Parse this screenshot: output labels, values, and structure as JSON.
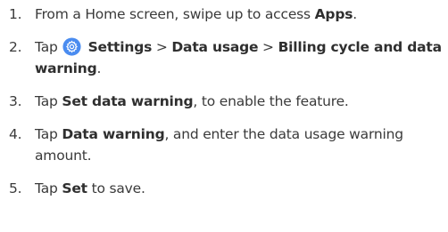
{
  "steps": [
    {
      "number": "1.",
      "parts": [
        {
          "text": "From a Home screen, swipe up to access ",
          "bold": false
        },
        {
          "text": "Apps",
          "bold": true
        },
        {
          "text": ".",
          "bold": false
        }
      ]
    },
    {
      "number": "2.",
      "parts": [
        {
          "text": "Tap ",
          "bold": false
        },
        {
          "icon": "settings-gear-icon"
        },
        {
          "text": " Settings",
          "bold": true
        },
        {
          "text": " > ",
          "bold": false
        },
        {
          "text": "Data usage",
          "bold": true
        },
        {
          "text": " > ",
          "bold": false
        },
        {
          "text": "Billing cycle and data warning",
          "bold": true
        },
        {
          "text": ".",
          "bold": false
        }
      ]
    },
    {
      "number": "3.",
      "parts": [
        {
          "text": "Tap ",
          "bold": false
        },
        {
          "text": "Set data warning",
          "bold": true
        },
        {
          "text": ", to enable the feature.",
          "bold": false
        }
      ]
    },
    {
      "number": "4.",
      "parts": [
        {
          "text": "Tap ",
          "bold": false
        },
        {
          "text": "Data warning",
          "bold": true
        },
        {
          "text": ", and enter the data usage warning amount.",
          "bold": false
        }
      ]
    },
    {
      "number": "5.",
      "parts": [
        {
          "text": "Tap ",
          "bold": false
        },
        {
          "text": "Set",
          "bold": true
        },
        {
          "text": " to save.",
          "bold": false
        }
      ]
    }
  ],
  "icon_colors": {
    "settings_bg": "#4a8cf0",
    "settings_fg": "#ffffff"
  }
}
